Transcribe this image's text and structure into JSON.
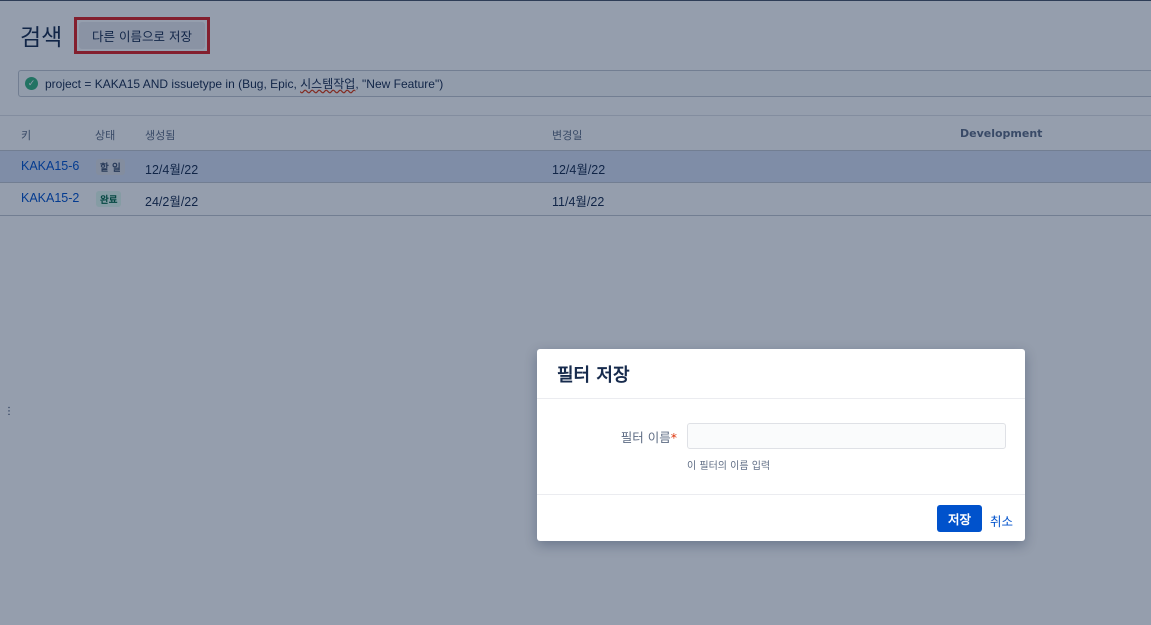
{
  "header": {
    "title": "검색",
    "save_as_label": "다른 이름으로 저장"
  },
  "jql": {
    "prefix": "project = KAKA15 AND issuetype in (Bug, Epic, ",
    "underlined": "시스템작업",
    "suffix": ", \"New Feature\")",
    "status_icon": "check-circle-icon"
  },
  "table": {
    "columns": [
      "키",
      "상태",
      "생성됨",
      "변경일",
      "Development"
    ],
    "rows": [
      {
        "key": "KAKA15-6",
        "status": "할 일",
        "created": "12/4월/22",
        "updated": "12/4월/22"
      },
      {
        "key": "KAKA15-2",
        "status": "완료",
        "created": "24/2월/22",
        "updated": "11/4월/22"
      }
    ]
  },
  "dialog": {
    "title": "필터 저장",
    "field_label": "필터 이름",
    "required_mark": "*",
    "field_value": "",
    "hint": "이 필터의 이름 입력",
    "save_label": "저장",
    "cancel_label": "취소"
  },
  "colors": {
    "accent": "#0052cc",
    "highlight_box": "#e02020",
    "done": "#006644"
  }
}
